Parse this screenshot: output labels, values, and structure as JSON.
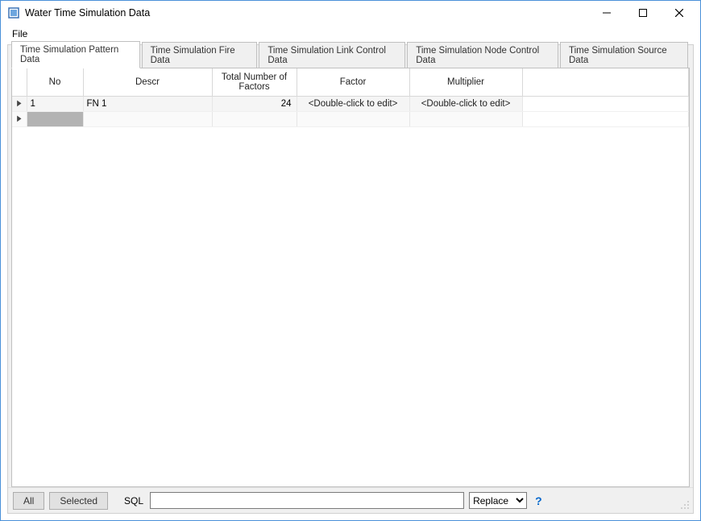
{
  "window": {
    "title": "Water Time Simulation Data"
  },
  "menubar": {
    "file": "File"
  },
  "tabs": [
    {
      "label": "Time Simulation Pattern Data",
      "active": true
    },
    {
      "label": "Time Simulation Fire Data",
      "active": false
    },
    {
      "label": "Time Simulation Link Control Data",
      "active": false
    },
    {
      "label": "Time Simulation Node Control Data",
      "active": false
    },
    {
      "label": "Time Simulation Source Data",
      "active": false
    }
  ],
  "grid": {
    "columns": {
      "no": "No",
      "descr": "Descr",
      "total": "Total Number of Factors",
      "factor": "Factor",
      "multiplier": "Multiplier"
    },
    "rows": [
      {
        "no": "1",
        "descr": "FN 1",
        "total": "24",
        "factor": "<Double-click to edit>",
        "multiplier": "<Double-click to edit>"
      }
    ]
  },
  "bottombar": {
    "all": "All",
    "selected": "Selected",
    "sql_label": "SQL",
    "sql_value": "",
    "replace": "Replace",
    "help": "?"
  }
}
